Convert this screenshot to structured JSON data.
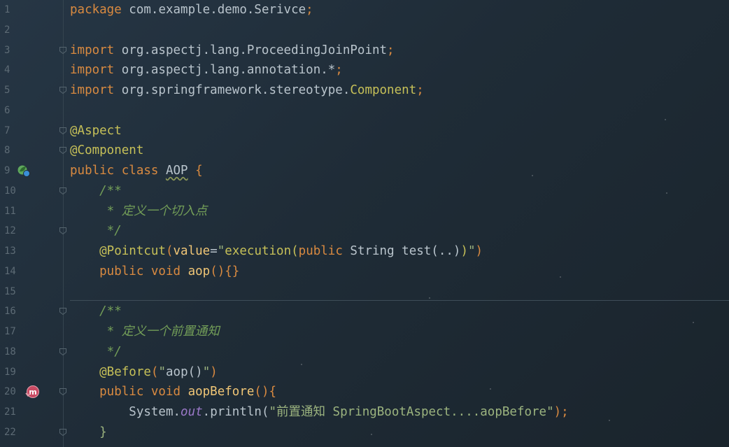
{
  "editor": {
    "file_language": "java",
    "lines": [
      {
        "n": "1",
        "tokens": [
          {
            "t": "package",
            "c": "kw"
          },
          {
            "t": " com.example.demo.Serivce",
            "c": "plain"
          },
          {
            "t": ";",
            "c": "kw"
          }
        ]
      },
      {
        "n": "2",
        "tokens": []
      },
      {
        "n": "3",
        "fold": true,
        "tokens": [
          {
            "t": "import",
            "c": "kw"
          },
          {
            "t": " org.aspectj.lang.ProceedingJoinPoint",
            "c": "plain"
          },
          {
            "t": ";",
            "c": "kw"
          }
        ]
      },
      {
        "n": "4",
        "tokens": [
          {
            "t": "import",
            "c": "kw"
          },
          {
            "t": " org.aspectj.lang.annotation.*",
            "c": "plain"
          },
          {
            "t": ";",
            "c": "kw"
          }
        ]
      },
      {
        "n": "5",
        "fold": true,
        "tokens": [
          {
            "t": "import",
            "c": "kw"
          },
          {
            "t": " org.springframework.stereotype.",
            "c": "plain"
          },
          {
            "t": "Component",
            "c": "cls-component"
          },
          {
            "t": ";",
            "c": "kw"
          }
        ]
      },
      {
        "n": "6",
        "tokens": []
      },
      {
        "n": "7",
        "fold": true,
        "tokens": [
          {
            "t": "@Aspect",
            "c": "ann"
          }
        ]
      },
      {
        "n": "8",
        "fold": true,
        "tokens": [
          {
            "t": "@Component",
            "c": "ann"
          }
        ]
      },
      {
        "n": "9",
        "icon": "spring-bean-icon",
        "tokens": [
          {
            "t": "public class ",
            "c": "kw"
          },
          {
            "t": "AOP",
            "c": "cls-aop"
          },
          {
            "t": " {",
            "c": "kw"
          }
        ]
      },
      {
        "n": "10",
        "fold": true,
        "tokens": [
          {
            "t": "    /**",
            "c": "cmt"
          }
        ]
      },
      {
        "n": "11",
        "tokens": [
          {
            "t": "     * 定义一个切入点",
            "c": "cmt"
          }
        ]
      },
      {
        "n": "12",
        "fold": true,
        "tokens": [
          {
            "t": "     */",
            "c": "cmt"
          }
        ]
      },
      {
        "n": "13",
        "tokens": [
          {
            "t": "    @Pointcut",
            "c": "ann"
          },
          {
            "t": "(",
            "c": "kw"
          },
          {
            "t": "value",
            "c": "fn"
          },
          {
            "t": "=",
            "c": "plain"
          },
          {
            "t": "\"",
            "c": "str"
          },
          {
            "t": "execution(",
            "c": "ann"
          },
          {
            "t": "public",
            "c": "kw"
          },
          {
            "t": " String test(..)",
            "c": "plain"
          },
          {
            "t": ")",
            "c": "ann"
          },
          {
            "t": "\"",
            "c": "str"
          },
          {
            "t": ")",
            "c": "kw"
          }
        ]
      },
      {
        "n": "14",
        "tokens": [
          {
            "t": "    public void ",
            "c": "kw"
          },
          {
            "t": "aop",
            "c": "fn"
          },
          {
            "t": "(){}",
            "c": "kw"
          }
        ]
      },
      {
        "n": "15",
        "tokens": []
      },
      {
        "n": "16",
        "fold": true,
        "tokens": [
          {
            "t": "    /**",
            "c": "cmt"
          }
        ]
      },
      {
        "n": "17",
        "tokens": [
          {
            "t": "     * 定义一个前置通知",
            "c": "cmt"
          }
        ]
      },
      {
        "n": "18",
        "fold": true,
        "tokens": [
          {
            "t": "     */",
            "c": "cmt"
          }
        ]
      },
      {
        "n": "19",
        "tokens": [
          {
            "t": "    @Before",
            "c": "ann"
          },
          {
            "t": "(",
            "c": "kw"
          },
          {
            "t": "\"",
            "c": "str"
          },
          {
            "t": "aop()",
            "c": "plain"
          },
          {
            "t": "\"",
            "c": "str"
          },
          {
            "t": ")",
            "c": "kw"
          }
        ]
      },
      {
        "n": "20",
        "fold": true,
        "icon": "advice-method-icon",
        "tokens": [
          {
            "t": "    public void ",
            "c": "kw"
          },
          {
            "t": "aopBefore",
            "c": "fn"
          },
          {
            "t": "(){",
            "c": "kw"
          }
        ]
      },
      {
        "n": "21",
        "tokens": [
          {
            "t": "        System.",
            "c": "plain"
          },
          {
            "t": "out",
            "c": "field"
          },
          {
            "t": ".println(",
            "c": "plain"
          },
          {
            "t": "\"前置通知 SpringBootAspect....aopBefore\"",
            "c": "str"
          },
          {
            "t": ");",
            "c": "kw"
          }
        ]
      },
      {
        "n": "22",
        "fold": true,
        "tokens": [
          {
            "t": "    }",
            "c": "str"
          }
        ]
      }
    ]
  },
  "colors": {
    "keyword": "#d98a40",
    "annotation": "#c6c058",
    "comment": "#739e58",
    "string": "#9cb47f",
    "method": "#f0c676",
    "static_field": "#9a78c8",
    "background": "#1f2c37"
  }
}
